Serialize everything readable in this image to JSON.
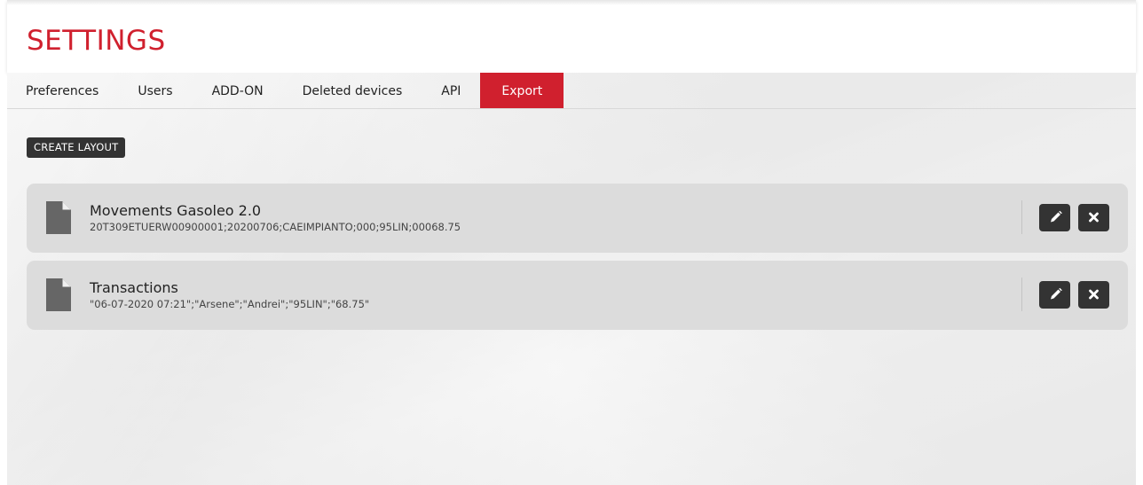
{
  "header": {
    "title": "SETTINGS"
  },
  "tabs": [
    {
      "label": "Preferences",
      "active": false
    },
    {
      "label": "Users",
      "active": false
    },
    {
      "label": "ADD-ON",
      "active": false
    },
    {
      "label": "Deleted devices",
      "active": false
    },
    {
      "label": "API",
      "active": false
    },
    {
      "label": "Export",
      "active": true
    }
  ],
  "toolbar": {
    "create_layout_label": "CREATE LAYOUT"
  },
  "layouts": [
    {
      "icon": "file-icon",
      "title": "Movements Gasoleo 2.0",
      "sample": "20T309ETUERW00900001;20200706;CAEIMPIANTO;000;95LIN;00068.75",
      "actions": [
        "pencil-icon",
        "close-icon"
      ]
    },
    {
      "icon": "file-icon",
      "title": "Transactions",
      "sample": "\"06-07-2020 07:21\";\"Arsene\";\"Andrei\";\"95LIN\";\"68.75\"",
      "actions": [
        "pencil-icon",
        "close-icon"
      ]
    }
  ],
  "colors": {
    "accent": "#d0202e",
    "dark_button": "#333333",
    "card_background": "#dcdcdc"
  }
}
